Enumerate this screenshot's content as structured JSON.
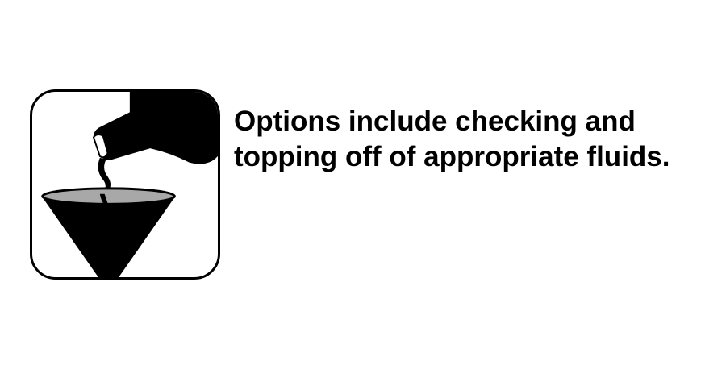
{
  "icon": {
    "name": "pouring-fluid-funnel-icon",
    "fill_color": "#000000",
    "liquid_color": "#a8a8a8"
  },
  "caption": {
    "line1": "Options include checking and",
    "line2": "topping off of appropriate fluids."
  }
}
